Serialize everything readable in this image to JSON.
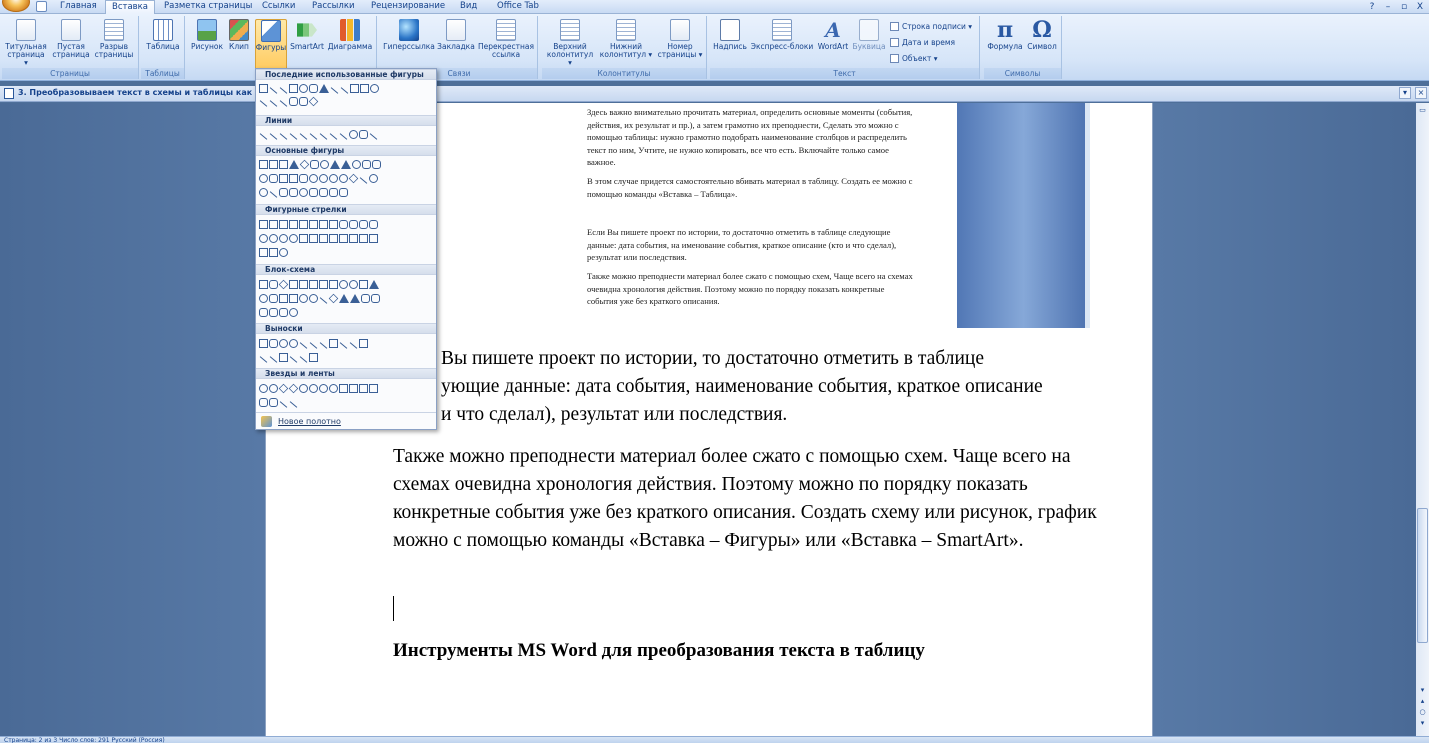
{
  "tabs": [
    "Главная",
    "Вставка",
    "Разметка страницы",
    "Ссылки",
    "Рассылки",
    "Рецензирование",
    "Вид",
    "Office Tab"
  ],
  "window_controls": [
    "?",
    "–",
    "▫",
    "X"
  ],
  "ribbon": {
    "pages": {
      "label": "Страницы",
      "cover": "Титульная страница ▾",
      "blank": "Пустая страница",
      "break": "Разрыв страницы"
    },
    "tables": {
      "label": "Таблицы",
      "table": "Таблица"
    },
    "illustrations": {
      "picture": "Рисунок",
      "clip": "Клип",
      "shapes": "Фигуры",
      "smartart": "SmartArt",
      "chart": "Диаграмма"
    },
    "links": {
      "label": "Связи",
      "hyperlink": "Гиперссылка",
      "bookmark": "Закладка",
      "xref": "Перекрестная ссылка"
    },
    "header_footer": {
      "label": "Колонтитулы",
      "header": "Верхний колонтитул ▾",
      "footer": "Нижний колонтитул ▾",
      "page_number": "Номер страницы ▾"
    },
    "text": {
      "label": "Текст",
      "textbox": "Надпись",
      "quickparts": "Экспресс-блоки",
      "wordart": "WordArt",
      "dropcap": "Буквица",
      "signature": "Строка подписи ▾",
      "datetime": "Дата и время",
      "object": "Объект ▾"
    },
    "symbols": {
      "label": "Символы",
      "equation": "Формула",
      "symbol": "Символ"
    }
  },
  "doc_tab": {
    "title": "3. Преобразовываем текст в схемы и таблицы как"
  },
  "shapes_menu": {
    "recent": "Последние использованные фигуры",
    "lines": "Линии",
    "basic": "Основные фигуры",
    "arrows": "Фигурные стрелки",
    "flowchart": "Блок-схема",
    "callouts": "Выноски",
    "stars": "Звезды и ленты",
    "new_canvas": "Новое полотно"
  },
  "embedded": {
    "p1": "Здесь важно внимательно прочитать материал, определить основные моменты (события, действия, их результат и пр.), а затем грамотно их преподнести, Сделать это можно с помощью таблицы: нужно грамотно подобрать наименование столбцов и распределить текст по ним, Учтите, не нужно копировать, все что есть. Включайте только самое важное.",
    "p2": "В этом случае придется самостоятельно вбивать материал в таблицу. Создать ее можно с помощью команды «Вставка – Таблица».",
    "p3": "Если Вы пишете проект по истории, то достаточно отметить в таблице следующие данные: дата события, на именование события, краткое описание (кто и что сделал), результат или последствия.",
    "p4": "Также можно преподнести материал более сжато с помощью схем, Чаще всего на схемах очевидна хронология действия. Поэтому можно по порядку показать конкретные события уже без краткого описания."
  },
  "body": {
    "p1_line1": "Вы пишете проект по истории, то достаточно отметить в таблице",
    "p1_line2": "ующие данные: дата события, наименование события, краткое описание",
    "p1_line3": "и что сделал), результат или последствия.",
    "p2": "Также можно преподнести материал более сжато с помощью схем. Чаще всего на схемах очевидна хронология действия. Поэтому можно по порядку показать конкретные события уже без краткого описания. Создать схему или рисунок, график можно с помощью команды «Вставка – Фигуры» или «Вставка – SmartArt».",
    "heading": "Инструменты MS Word для преобразования текста в таблицу"
  },
  "status": "Страница: 2 из 3   Число слов: 291   Русский (Россия)"
}
